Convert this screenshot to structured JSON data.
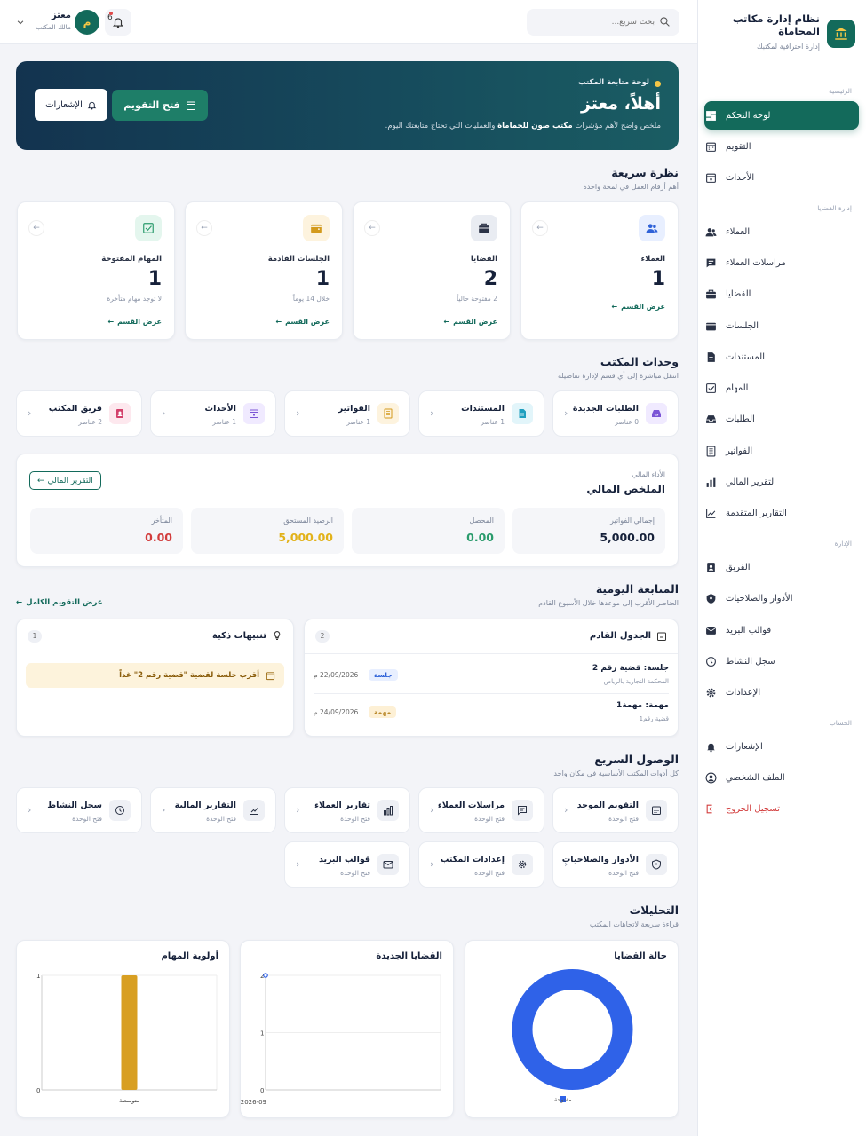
{
  "brand": {
    "title": "نظام إدارة مكاتب المحاماة",
    "subtitle": "إدارة احترافية لمكتبك"
  },
  "sidebar": {
    "sections": {
      "main": "الرئيسية",
      "cases": "إدارة القضايا",
      "admin": "الإدارة",
      "account": "الحساب"
    },
    "items": [
      {
        "label": "لوحة التحكم",
        "icon": "dashboard-icon"
      },
      {
        "label": "التقويم",
        "icon": "calendar-icon"
      },
      {
        "label": "الأحداث",
        "icon": "event-icon"
      },
      {
        "label": "العملاء",
        "icon": "users-icon"
      },
      {
        "label": "مراسلات العملاء",
        "icon": "chat-icon"
      },
      {
        "label": "القضايا",
        "icon": "briefcase-icon"
      },
      {
        "label": "الجلسات",
        "icon": "wallet-icon"
      },
      {
        "label": "المستندات",
        "icon": "document-icon"
      },
      {
        "label": "المهام",
        "icon": "checkbox-icon"
      },
      {
        "label": "الطلبات",
        "icon": "inbox-icon"
      },
      {
        "label": "الفواتير",
        "icon": "invoice-icon"
      },
      {
        "label": "التقرير المالي",
        "icon": "bar-chart-icon"
      },
      {
        "label": "التقارير المتقدمة",
        "icon": "line-chart-icon"
      },
      {
        "label": "الفريق",
        "icon": "id-card-icon"
      },
      {
        "label": "الأدوار والصلاحيات",
        "icon": "shield-icon"
      },
      {
        "label": "قوالب البريد",
        "icon": "mail-icon"
      },
      {
        "label": "سجل النشاط",
        "icon": "clock-icon"
      },
      {
        "label": "الإعدادات",
        "icon": "gear-icon"
      },
      {
        "label": "الإشعارات",
        "icon": "bell-icon"
      },
      {
        "label": "الملف الشخصي",
        "icon": "user-circle-icon"
      },
      {
        "label": "تسجيل الخروج",
        "icon": "logout-icon"
      }
    ]
  },
  "topbar": {
    "search_placeholder": "بحث سريع...",
    "user_name": "معتز",
    "user_role": "مالك المكتب",
    "avatar_letter": "م",
    "notif_count": "6"
  },
  "hero": {
    "kicker": "لوحة متابعة المكتب",
    "greeting": "أهلاً، معتز",
    "desc_a": "ملخص واضح لأهم مؤشرات ",
    "desc_b": "مكتب صون للحماماة",
    "desc_c": " والعمليات التي تحتاج متابعتك اليوم.",
    "btn_calendar": "فتح التقويم",
    "btn_notifications": "الإشعارات"
  },
  "quick": {
    "title": "نظرة سريعة",
    "subtitle": "أهم أرقام العمل في لمحة واحدة",
    "view_section": "عرض القسم",
    "stats": [
      {
        "label": "العملاء",
        "value": "1",
        "note": "",
        "color": "#2f62d8",
        "bg": "#e8efff"
      },
      {
        "label": "القضايا",
        "value": "2",
        "note": "2 مفتوحة حالياً",
        "color": "#2c3347",
        "bg": "#e9ecf2"
      },
      {
        "label": "الجلسات القادمة",
        "value": "1",
        "note": "خلال 14 يوماً",
        "color": "#d39a1c",
        "bg": "#fdf3de"
      },
      {
        "label": "المهام المفتوحة",
        "value": "1",
        "note": "لا توجد مهام متأخرة",
        "color": "#2a9b6c",
        "bg": "#e4f6ee"
      }
    ]
  },
  "units": {
    "title": "وحدات المكتب",
    "subtitle": "انتقل مباشرة إلى أي قسم لإدارة تفاصيله",
    "items": [
      {
        "label": "الطلبات الجديدة",
        "count": "0 عناصر",
        "color": "#7b55d6",
        "bg": "#f0eaff"
      },
      {
        "label": "المستندات",
        "count": "1 عناصر",
        "color": "#1f9fbf",
        "bg": "#e2f5fa"
      },
      {
        "label": "الفواتير",
        "count": "1 عناصر",
        "color": "#d39a1c",
        "bg": "#fdf3de"
      },
      {
        "label": "الأحداث",
        "count": "1 عناصر",
        "color": "#7b55d6",
        "bg": "#f0eaff"
      },
      {
        "label": "فريق المكتب",
        "count": "2 عناصر",
        "color": "#d3416b",
        "bg": "#fde8ee"
      }
    ]
  },
  "finance": {
    "kicker": "الأداء المالي",
    "title": "الملخص المالي",
    "report_btn": "التقرير المالي",
    "boxes": [
      {
        "label": "إجمالي الفواتير",
        "value": "5,000.00",
        "color": "#16213a"
      },
      {
        "label": "المحصل",
        "value": "0.00",
        "color": "#2a9b6c"
      },
      {
        "label": "الرصيد المستحق",
        "value": "5,000.00",
        "color": "#e2b21a"
      },
      {
        "label": "المتأخر",
        "value": "0.00",
        "color": "#d23c3c"
      }
    ]
  },
  "daily": {
    "title": "المتابعة اليومية",
    "subtitle": "العناصر الأقرب إلى موعدها خلال الأسبوع القادم",
    "full_calendar": "عرض التقويم الكامل",
    "schedule": {
      "title": "الجدول القادم",
      "count": "2",
      "rows": [
        {
          "title": "جلسة: قضية رقم 2",
          "sub": "المحكمة التجارية بالرياض",
          "badge": "جلسة",
          "badge_color": "#2f62d8",
          "badge_bg": "#e8efff",
          "date": "22/09/2026 م"
        },
        {
          "title": "مهمة: مهمة1",
          "sub": "قضية رقم1",
          "badge": "مهمة",
          "badge_color": "#b07a12",
          "badge_bg": "#fdf0d5",
          "date": "24/09/2026 م"
        }
      ]
    },
    "alerts": {
      "title": "تنبيهات ذكية",
      "count": "1",
      "items": [
        "أقرب جلسة لقضية \"قضية رقم 2\" غداً"
      ]
    }
  },
  "access": {
    "title": "الوصول السريع",
    "subtitle": "كل أدوات المكتب الأساسية في مكان واحد",
    "open_unit": "فتح الوحدة",
    "items": [
      {
        "label": "التقويم الموحد",
        "icon": "calendar-icon"
      },
      {
        "label": "مراسلات العملاء",
        "icon": "chat-icon"
      },
      {
        "label": "تقارير العملاء",
        "icon": "bar-chart-icon"
      },
      {
        "label": "التقارير المالية",
        "icon": "line-chart-icon"
      },
      {
        "label": "سجل النشاط",
        "icon": "clock-icon"
      },
      {
        "label": "الأدوار والصلاحيات",
        "icon": "shield-icon"
      },
      {
        "label": "إعدادات المكتب",
        "icon": "gear-icon"
      },
      {
        "label": "قوالب البريد",
        "icon": "mail-icon"
      }
    ]
  },
  "analytics": {
    "title": "التحليلات",
    "subtitle": "قراءة سريعة لاتجاهات المكتب"
  },
  "chart_data": [
    {
      "type": "pie",
      "title": "حالة القضايا",
      "categories": [
        "مفتوحة"
      ],
      "values": [
        2
      ],
      "colors": [
        "#2f62e8"
      ],
      "legend": "bottom"
    },
    {
      "type": "line",
      "title": "القضايا الجديدة",
      "x": [
        "2026-09"
      ],
      "series": [
        {
          "values": [
            2
          ]
        }
      ],
      "ylim": [
        0,
        2
      ],
      "yticks": [
        0,
        1,
        2
      ],
      "grid": true,
      "color": "#2f62e8"
    },
    {
      "type": "bar",
      "title": "أولوية المهام",
      "categories": [
        "متوسطة"
      ],
      "values": [
        1
      ],
      "ylim": [
        0,
        1
      ],
      "yticks": [
        0,
        1
      ],
      "grid": true,
      "color": "#d89f22"
    }
  ]
}
